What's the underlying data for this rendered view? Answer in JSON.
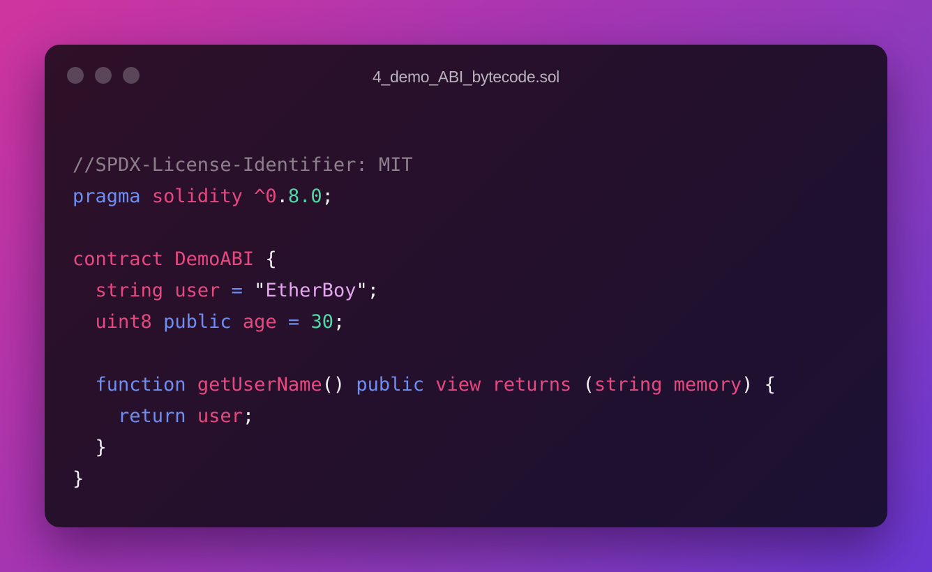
{
  "window": {
    "title": "4_demo_ABI_bytecode.sol",
    "title_color": "#b8b2bc",
    "dots": [
      {
        "name": "close",
        "color": "#5a4658"
      },
      {
        "name": "minimize",
        "color": "#5a4658"
      },
      {
        "name": "maximize",
        "color": "#5a4658"
      }
    ]
  },
  "colors": {
    "comment": "#8d7f8c",
    "keyword_blue": "#6f8ef2",
    "keyword_pink": "#e6497f",
    "number_green": "#4fd9a5",
    "string_purple": "#e5a6f0",
    "default": "#f5f2f6"
  },
  "code": {
    "lines": [
      [
        {
          "t": "//SPDX-License-Identifier: MIT",
          "c": "comment"
        }
      ],
      [
        {
          "t": "pragma",
          "c": "keyword_blue"
        },
        {
          "t": " ",
          "c": "default"
        },
        {
          "t": "solidity ^0",
          "c": "keyword_pink"
        },
        {
          "t": ".",
          "c": "default"
        },
        {
          "t": "8.0",
          "c": "number_green"
        },
        {
          "t": ";",
          "c": "default"
        }
      ],
      [],
      [
        {
          "t": "contract",
          "c": "keyword_pink"
        },
        {
          "t": " ",
          "c": "default"
        },
        {
          "t": "DemoABI",
          "c": "keyword_pink"
        },
        {
          "t": " {",
          "c": "default"
        }
      ],
      [
        {
          "t": "  ",
          "c": "default"
        },
        {
          "t": "string",
          "c": "keyword_pink"
        },
        {
          "t": " ",
          "c": "default"
        },
        {
          "t": "user",
          "c": "keyword_pink"
        },
        {
          "t": " = ",
          "c": "keyword_blue"
        },
        {
          "t": "\"",
          "c": "default"
        },
        {
          "t": "EtherBoy",
          "c": "string_purple"
        },
        {
          "t": "\";",
          "c": "default"
        }
      ],
      [
        {
          "t": "  ",
          "c": "default"
        },
        {
          "t": "uint8",
          "c": "keyword_pink"
        },
        {
          "t": " ",
          "c": "default"
        },
        {
          "t": "public",
          "c": "keyword_blue"
        },
        {
          "t": " ",
          "c": "default"
        },
        {
          "t": "age",
          "c": "keyword_pink"
        },
        {
          "t": " = ",
          "c": "keyword_blue"
        },
        {
          "t": "30",
          "c": "number_green"
        },
        {
          "t": ";",
          "c": "default"
        }
      ],
      [],
      [
        {
          "t": "  ",
          "c": "default"
        },
        {
          "t": "function",
          "c": "keyword_blue"
        },
        {
          "t": " ",
          "c": "default"
        },
        {
          "t": "getUserName",
          "c": "keyword_pink"
        },
        {
          "t": "() ",
          "c": "default"
        },
        {
          "t": "public",
          "c": "keyword_blue"
        },
        {
          "t": " ",
          "c": "default"
        },
        {
          "t": "view returns",
          "c": "keyword_pink"
        },
        {
          "t": " (",
          "c": "default"
        },
        {
          "t": "string memory",
          "c": "keyword_pink"
        },
        {
          "t": ") {",
          "c": "default"
        }
      ],
      [
        {
          "t": "    ",
          "c": "default"
        },
        {
          "t": "return",
          "c": "keyword_blue"
        },
        {
          "t": " ",
          "c": "default"
        },
        {
          "t": "user",
          "c": "keyword_pink"
        },
        {
          "t": ";",
          "c": "default"
        }
      ],
      [
        {
          "t": "  }",
          "c": "default"
        }
      ],
      [
        {
          "t": "}",
          "c": "default"
        }
      ]
    ]
  }
}
